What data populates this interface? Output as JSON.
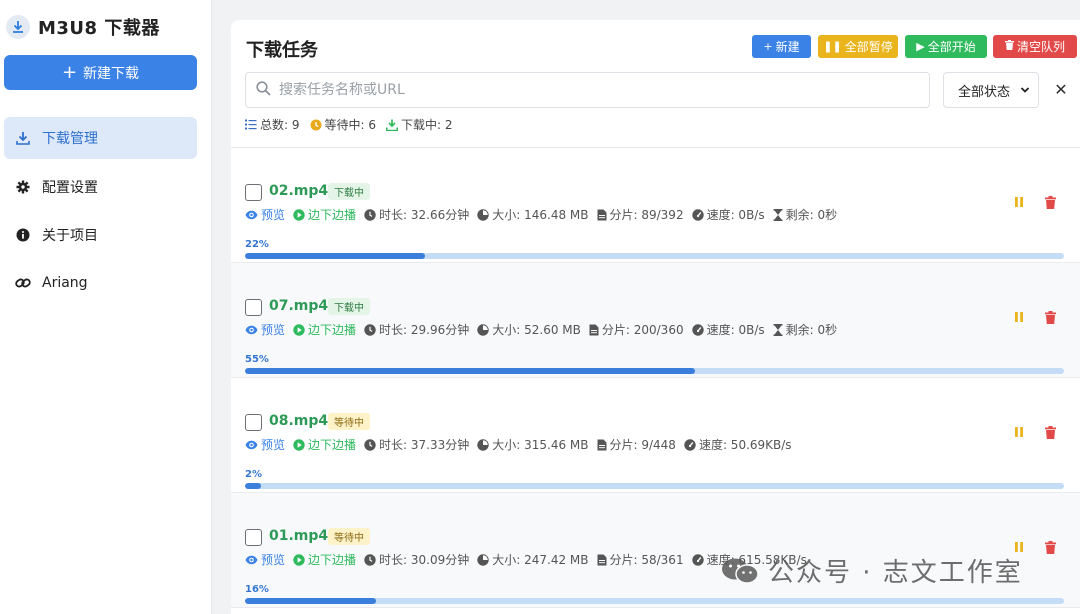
{
  "app": {
    "title": "M3U8 下载器",
    "new_download_label": "新建下载"
  },
  "sidebar": {
    "items": [
      {
        "label": "下载管理",
        "icon": "download-icon",
        "active": true
      },
      {
        "label": "配置设置",
        "icon": "gear-icon",
        "active": false
      },
      {
        "label": "关于项目",
        "icon": "info-icon",
        "active": false
      },
      {
        "label": "Ariang",
        "icon": "link-icon",
        "active": false
      }
    ]
  },
  "main": {
    "title": "下载任务",
    "toolbar": {
      "new_label": "新建",
      "pause_all_label": "全部暂停",
      "start_all_label": "全部开始",
      "clear_queue_label": "清空队列"
    },
    "search": {
      "placeholder": "搜索任务名称或URL",
      "value": ""
    },
    "status_filter": {
      "selected": "全部状态"
    },
    "stats": {
      "total": "总数: 9",
      "waiting": "等待中: 6",
      "downloading": "下载中: 2"
    }
  },
  "labels": {
    "preview": "预览",
    "play_while_download": "边下边播"
  },
  "tasks": [
    {
      "name": "02.mp4",
      "status": "下载中",
      "duration": "时长: 32.66分钟",
      "size": "大小: 146.48 MB",
      "segments": "分片: 89/392",
      "speed": "速度: 0B/s",
      "remaining": "剩余: 0秒",
      "progress_label": "22%",
      "progress": 0.22
    },
    {
      "name": "07.mp4",
      "status": "下载中",
      "duration": "时长: 29.96分钟",
      "size": "大小: 52.60 MB",
      "segments": "分片: 200/360",
      "speed": "速度: 0B/s",
      "remaining": "剩余: 0秒",
      "progress_label": "55%",
      "progress": 0.55
    },
    {
      "name": "08.mp4",
      "status": "等待中",
      "duration": "时长: 37.33分钟",
      "size": "大小: 315.46 MB",
      "segments": "分片: 9/448",
      "speed": "速度: 50.69KB/s",
      "remaining": "",
      "progress_label": "2%",
      "progress": 0.02
    },
    {
      "name": "01.mp4",
      "status": "等待中",
      "duration": "时长: 30.09分钟",
      "size": "大小: 247.42 MB",
      "segments": "分片: 58/361",
      "speed": "速度: 615.58KB/s",
      "remaining": "",
      "progress_label": "16%",
      "progress": 0.16
    }
  ],
  "watermark": "公众号 · 志文工作室",
  "colors": {
    "primary": "#3b82e6",
    "warning": "#e9b41c",
    "success": "#2fba5e",
    "danger": "#e24a4a",
    "filename": "#2e9a57",
    "progress_track": "#c5dcf6",
    "progress_fill": "#3b7fdc"
  }
}
